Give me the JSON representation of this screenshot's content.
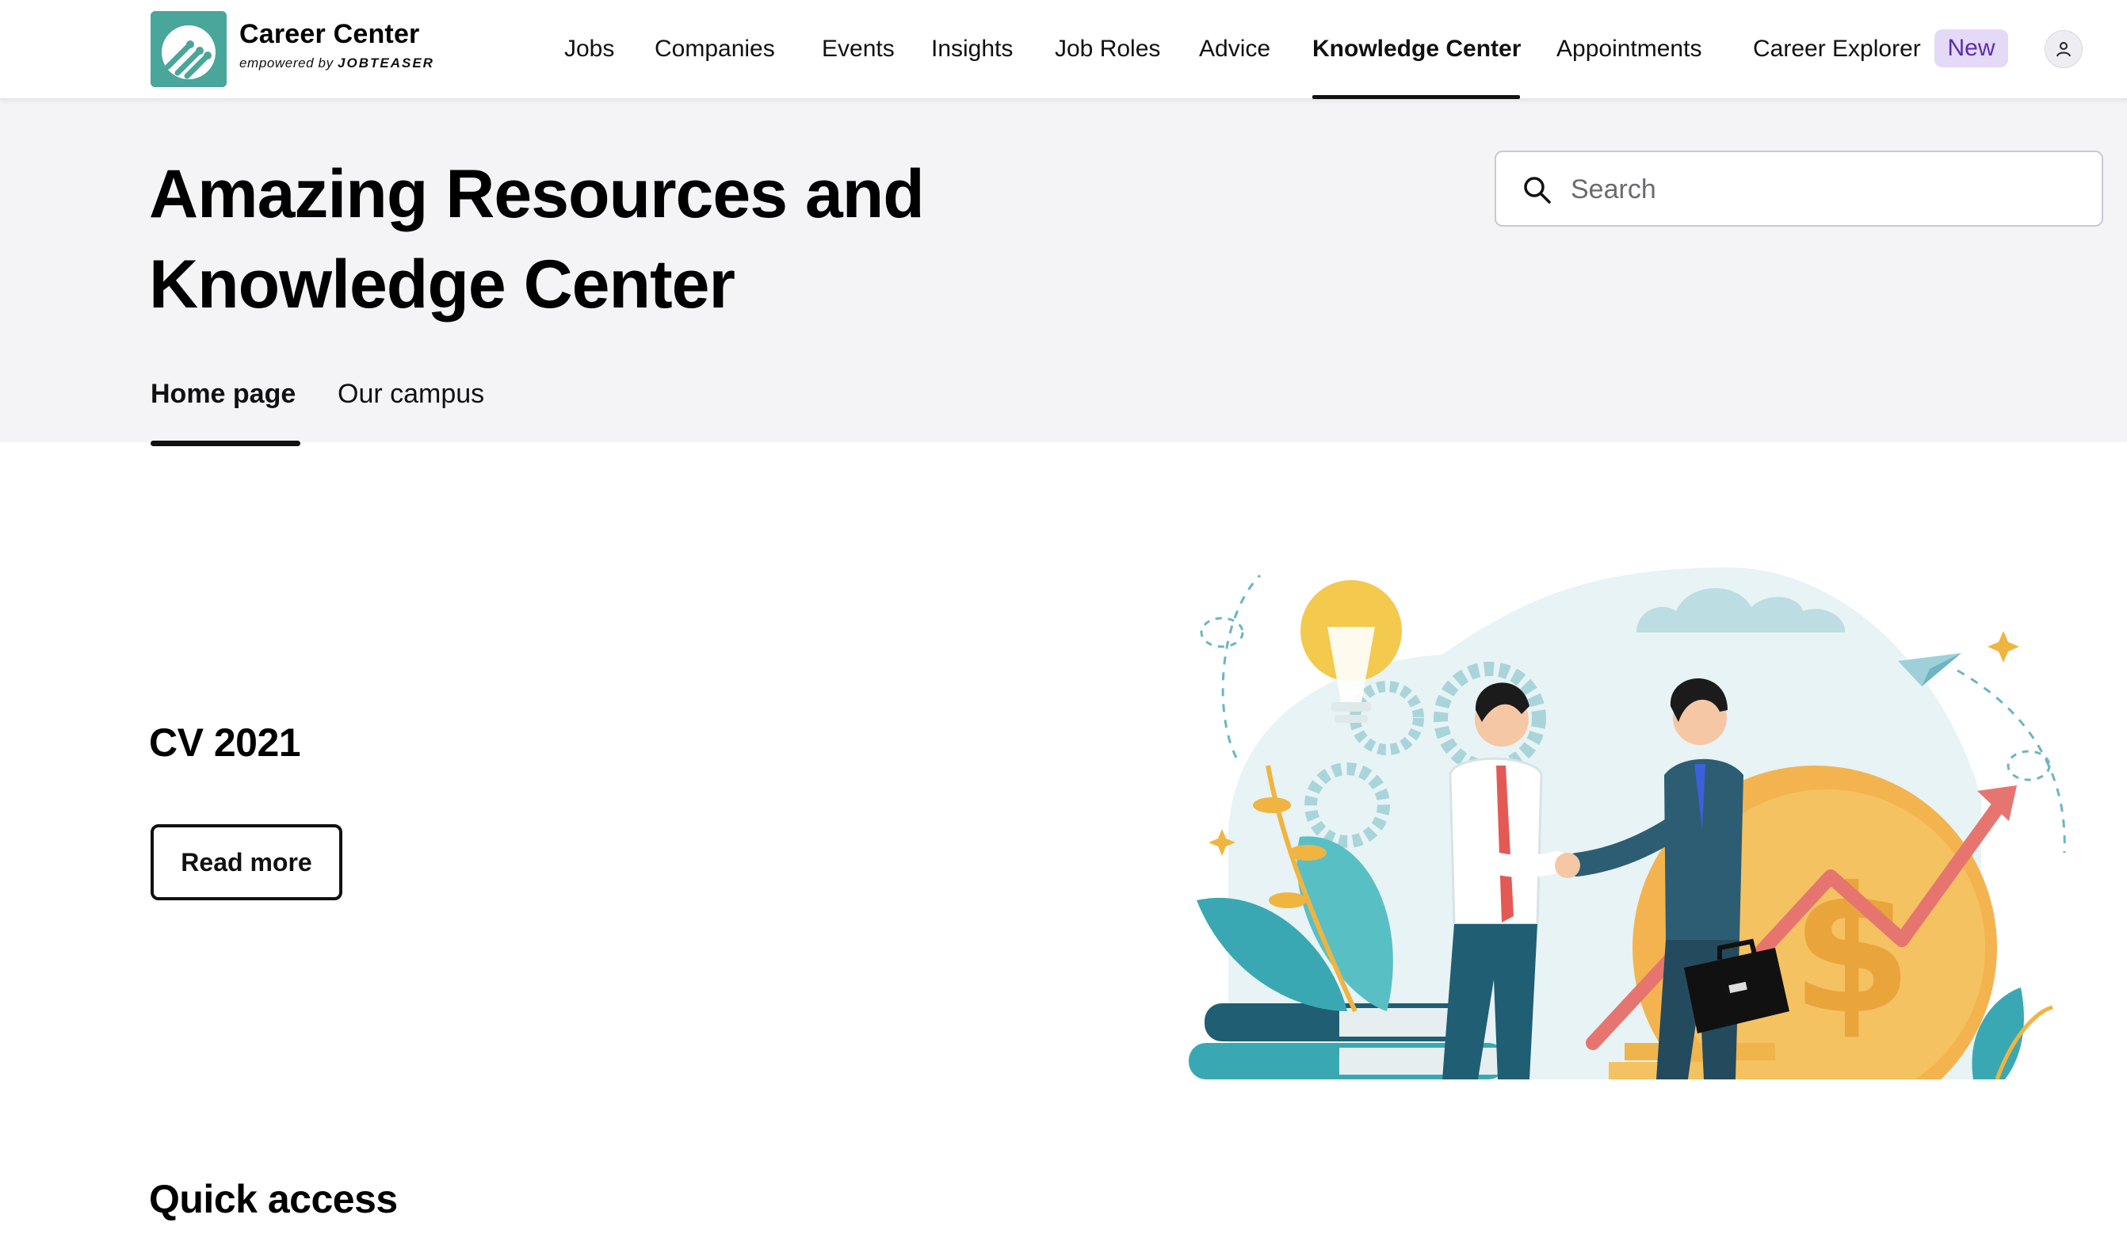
{
  "brand": {
    "name": "Career Center",
    "powered_prefix": "empowered by",
    "powered_brand": "JOBTEASER",
    "logo_color": "#4aa59a"
  },
  "nav": {
    "items": [
      {
        "label": "Jobs"
      },
      {
        "label": "Companies"
      },
      {
        "label": "Events"
      },
      {
        "label": "Insights"
      },
      {
        "label": "Job Roles"
      },
      {
        "label": "Advice"
      },
      {
        "label": "Knowledge Center",
        "active": true
      },
      {
        "label": "Appointments"
      },
      {
        "label": "Career Explorer"
      }
    ],
    "new_badge": "New",
    "profile_icon": "user-icon"
  },
  "hero": {
    "title": "Amazing Resources and Knowledge Center",
    "search": {
      "placeholder": "Search",
      "value": "",
      "icon": "search-icon"
    },
    "tabs": [
      {
        "label": "Home page",
        "active": true
      },
      {
        "label": "Our campus"
      }
    ]
  },
  "featured": {
    "title": "CV 2021",
    "button_label": "Read more",
    "illustration": "business-handshake-illustration"
  },
  "sections": {
    "quick_access_title": "Quick access"
  },
  "colors": {
    "accent_teal": "#4aa59a",
    "badge_bg": "#e4d9f6",
    "badge_text": "#5b2bb1",
    "hero_bg": "#f4f4f6"
  }
}
